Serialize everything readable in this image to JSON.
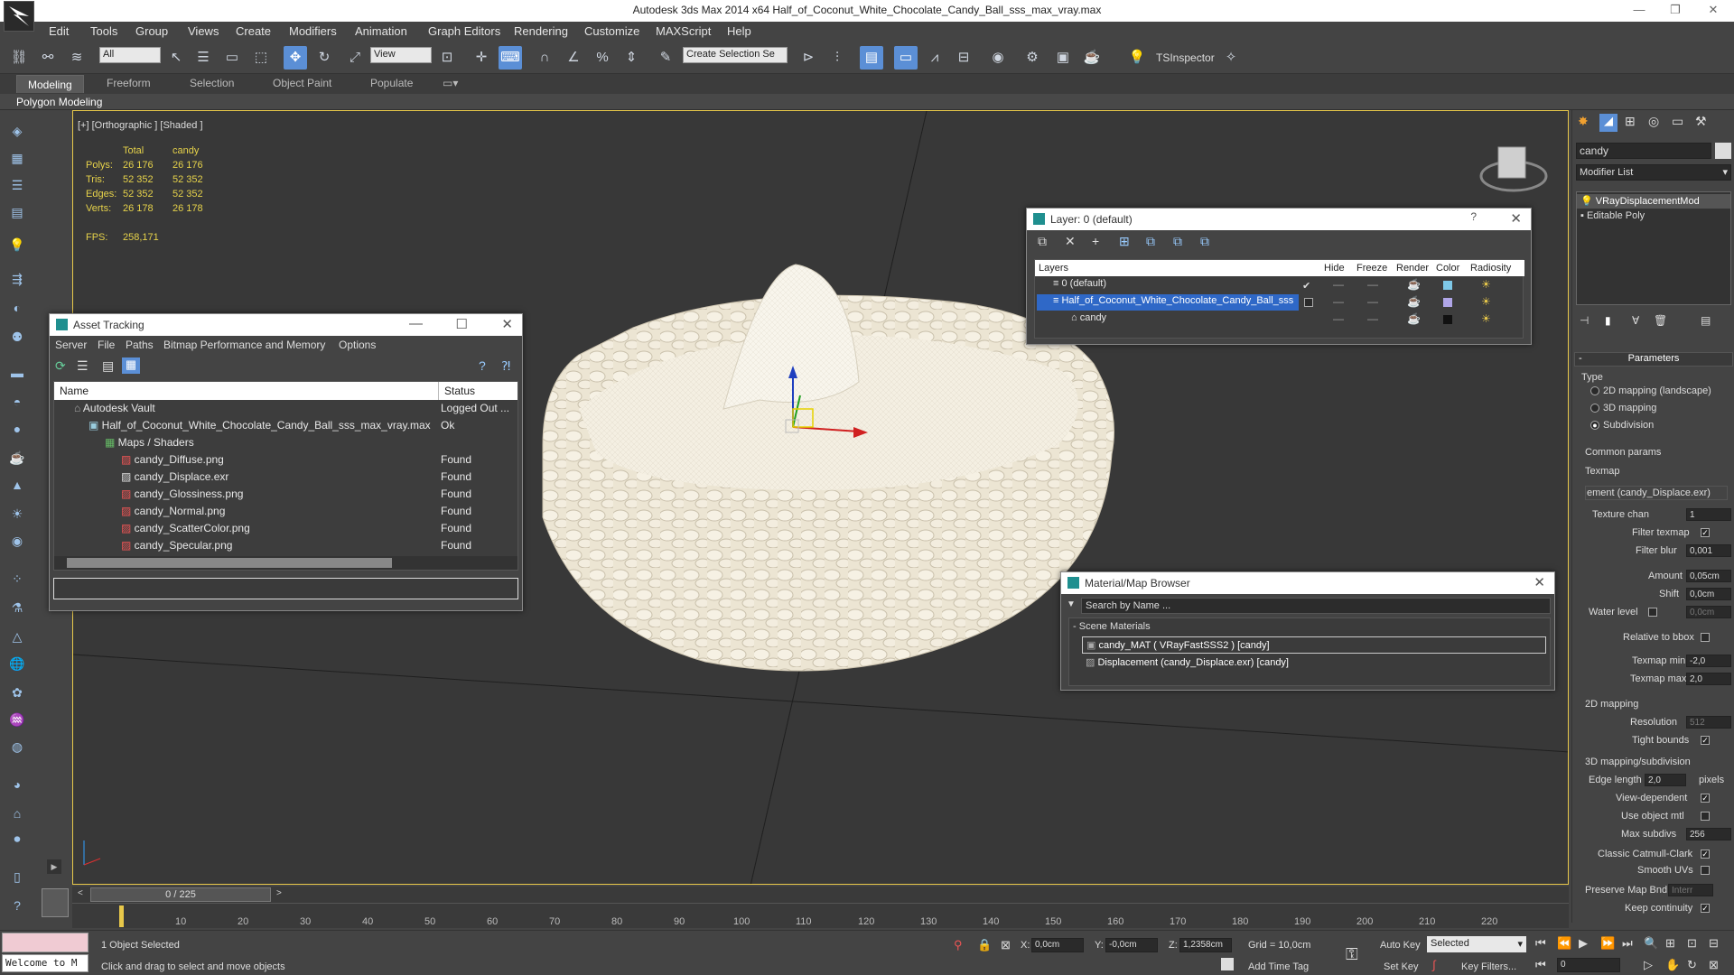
{
  "title": "Autodesk 3ds Max  2014 x64     Half_of_Coconut_White_Chocolate_Candy_Ball_sss_max_vray.max",
  "menu": [
    "Edit",
    "Tools",
    "Group",
    "Views",
    "Create",
    "Modifiers",
    "Animation",
    "Graph Editors",
    "Rendering",
    "Customize",
    "MAXScript",
    "Help"
  ],
  "toolbar": {
    "filter": "All",
    "refcoord": "View",
    "selset": "Create Selection Se",
    "plugin": "TSInspector"
  },
  "ribbon_tabs": [
    "Modeling",
    "Freeform",
    "Selection",
    "Object Paint",
    "Populate"
  ],
  "polygon_modeling": "Polygon Modeling",
  "viewport": {
    "label": "[+] [Orthographic ] [Shaded ]",
    "stats_header": [
      "Total",
      "candy"
    ],
    "stats": [
      {
        "k": "Polys:",
        "t": "26 176",
        "c": "26 176"
      },
      {
        "k": "Tris:",
        "t": "52 352",
        "c": "52 352"
      },
      {
        "k": "Edges:",
        "t": "52 352",
        "c": "52 352"
      },
      {
        "k": "Verts:",
        "t": "26 178",
        "c": "26 178"
      }
    ],
    "fps_label": "FPS:",
    "fps": "258,171"
  },
  "asset": {
    "title": "Asset Tracking",
    "menu": [
      "Server",
      "File",
      "Paths",
      "Bitmap Performance and Memory",
      "Options"
    ],
    "col_name": "Name",
    "col_status": "Status",
    "rows": [
      {
        "name": "Autodesk Vault",
        "status": "Logged Out ..."
      },
      {
        "name": "Half_of_Coconut_White_Chocolate_Candy_Ball_sss_max_vray.max",
        "status": "Ok"
      },
      {
        "name": "Maps / Shaders",
        "status": ""
      },
      {
        "name": "candy_Diffuse.png",
        "status": "Found"
      },
      {
        "name": "candy_Displace.exr",
        "status": "Found"
      },
      {
        "name": "candy_Glossiness.png",
        "status": "Found"
      },
      {
        "name": "candy_Normal.png",
        "status": "Found"
      },
      {
        "name": "candy_ScatterColor.png",
        "status": "Found"
      },
      {
        "name": "candy_Specular.png",
        "status": "Found"
      }
    ]
  },
  "layer": {
    "title": "Layer: 0 (default)",
    "cols": [
      "Layers",
      "Hide",
      "Freeze",
      "Render",
      "Color",
      "Radiosity"
    ],
    "rows": [
      "0 (default)",
      "Half_of_Coconut_White_Chocolate_Candy_Ball_sss",
      "candy"
    ],
    "help": "?"
  },
  "matbrowser": {
    "title": "Material/Map Browser",
    "search": "Search by Name ...",
    "section": "Scene Materials",
    "items": [
      "candy_MAT  ( VRayFastSSS2 )  [candy]",
      "Displacement (candy_Displace.exr)  [candy]"
    ]
  },
  "panel": {
    "object_name": "candy",
    "modifier_list": "Modifier List",
    "stack": [
      "VRayDisplacementMod",
      "Editable Poly"
    ],
    "params_title": "Parameters",
    "type_label": "Type",
    "types": [
      "2D mapping (landscape)",
      "3D mapping",
      "Subdivision"
    ],
    "common": "Common params",
    "texmap": "Texmap",
    "texmap_val": "ement (candy_Displace.exr)",
    "texture_chan": "Texture chan",
    "texture_chan_val": "1",
    "filter_texmap": "Filter texmap",
    "filter_blur": "Filter blur",
    "filter_blur_val": "0,001",
    "amount": "Amount",
    "amount_val": "0,05cm",
    "shift": "Shift",
    "shift_val": "0,0cm",
    "water": "Water level",
    "water_val": "0,0cm",
    "relative": "Relative to bbox",
    "tmin": "Texmap min",
    "tmin_val": "-2,0",
    "tmax": "Texmap max",
    "tmax_val": "2,0",
    "map2d": "2D mapping",
    "resolution": "Resolution",
    "resolution_val": "512",
    "tight": "Tight bounds",
    "map3d": "3D mapping/subdivision",
    "edge": "Edge length",
    "edge_val": "2,0",
    "pixels": "pixels",
    "viewdep": "View-dependent",
    "useobj": "Use object mtl",
    "maxsub": "Max subdivs",
    "maxsub_val": "256",
    "catmull": "Classic Catmull-Clark",
    "smooth": "Smooth UVs",
    "preserve": "Preserve Map Bnd",
    "preserve_val": "Interr",
    "keep": "Keep continuity"
  },
  "timeline": {
    "frame": "0 / 225",
    "ticks": [
      "10",
      "20",
      "30",
      "40",
      "50",
      "60",
      "70",
      "80",
      "90",
      "100",
      "110",
      "120",
      "130",
      "140",
      "150",
      "160",
      "170",
      "180",
      "190",
      "200",
      "210",
      "220"
    ]
  },
  "status": {
    "welcome": "Welcome to M",
    "selected": "1 Object Selected",
    "hint": "Click and drag to select and move objects",
    "x": "0,0cm",
    "y": "-0,0cm",
    "z": "1,2358cm",
    "grid": "Grid = 10,0cm",
    "autokey": "Auto Key",
    "setkey": "Set Key",
    "selmode": "Selected",
    "keyfilters": "Key Filters...",
    "addtag": "Add Time Tag",
    "frame": "0"
  }
}
